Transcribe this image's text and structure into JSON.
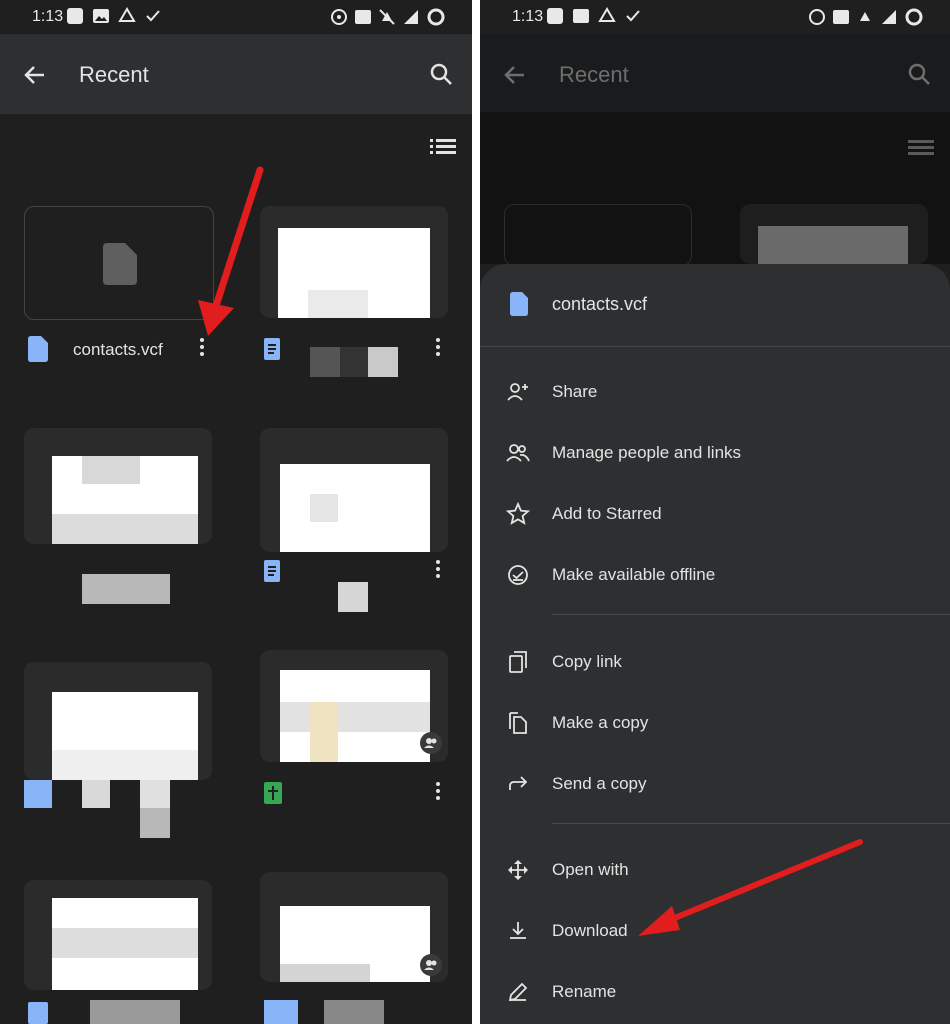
{
  "status": {
    "time": "1:13"
  },
  "left": {
    "header": {
      "title": "Recent"
    },
    "files": [
      {
        "name": "contacts.vcf"
      }
    ]
  },
  "right": {
    "header": {
      "title": "Recent"
    },
    "sheet": {
      "file_name": "contacts.vcf",
      "items": [
        {
          "label": "Share",
          "icon": "person-add-icon"
        },
        {
          "label": "Manage people and links",
          "icon": "people-icon"
        },
        {
          "label": "Add to Starred",
          "icon": "star-icon"
        },
        {
          "label": "Make available offline",
          "icon": "offline-icon"
        },
        {
          "label": "Copy link",
          "icon": "copy-link-icon"
        },
        {
          "label": "Make a copy",
          "icon": "copy-icon"
        },
        {
          "label": "Send a copy",
          "icon": "send-icon"
        },
        {
          "label": "Open with",
          "icon": "open-with-icon"
        },
        {
          "label": "Download",
          "icon": "download-icon"
        },
        {
          "label": "Rename",
          "icon": "rename-icon"
        }
      ]
    }
  },
  "colors": {
    "background": "#1f1f1f",
    "appbar": "#2d2f31",
    "text": "#e3e3e3",
    "arrow": "#e11d1d",
    "file_blue": "#8ab4f8"
  }
}
